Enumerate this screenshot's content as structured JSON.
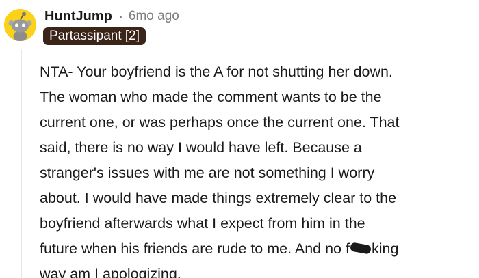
{
  "comment": {
    "author": "HuntJump",
    "separator": "·",
    "timestamp": "6mo ago",
    "flair": "Partassipant [2]",
    "avatar_icon": "snoo-avatar-icon",
    "avatar_color": "#fbd219",
    "flair_color": "#3b2418",
    "body_lines": [
      "NTA- Your boyfriend is the A for not shutting her down.",
      "The woman who made the comment wants to be the",
      "current one, or was perhaps once the current one. That",
      "said, there is no way I would have left. Because a",
      "stranger's issues with me are not something I worry",
      "about. I would have made things extremely clear to the",
      "boyfriend afterwards what I expect from him in the",
      {
        "before": "future when his friends are rude to me. And no f",
        "after": "king"
      },
      "way am I apologizing."
    ]
  }
}
